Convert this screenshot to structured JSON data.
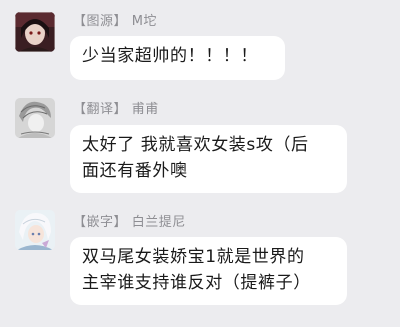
{
  "messages": [
    {
      "role": "图源",
      "name": "M坨",
      "lines": [
        "少当家超帅的！！！！"
      ],
      "avatar_icon": "dark-haired-character-avatar"
    },
    {
      "role": "翻译",
      "name": "甫甫",
      "lines": [
        "太好了 我就喜欢女装s攻（后",
        "面还有番外噢"
      ],
      "avatar_icon": "grey-sketch-character-avatar"
    },
    {
      "role": "嵌字",
      "name": "白兰提尼",
      "lines": [
        "双马尾女装娇宝1就是世界的",
        "主宰谁支持谁反对（提裤子）"
      ],
      "avatar_icon": "white-haired-character-avatar"
    }
  ],
  "colors": {
    "background": "#ececef",
    "bubble": "#ffffff",
    "sender_text": "#8e8e93",
    "message_text": "#1a1a1a"
  }
}
